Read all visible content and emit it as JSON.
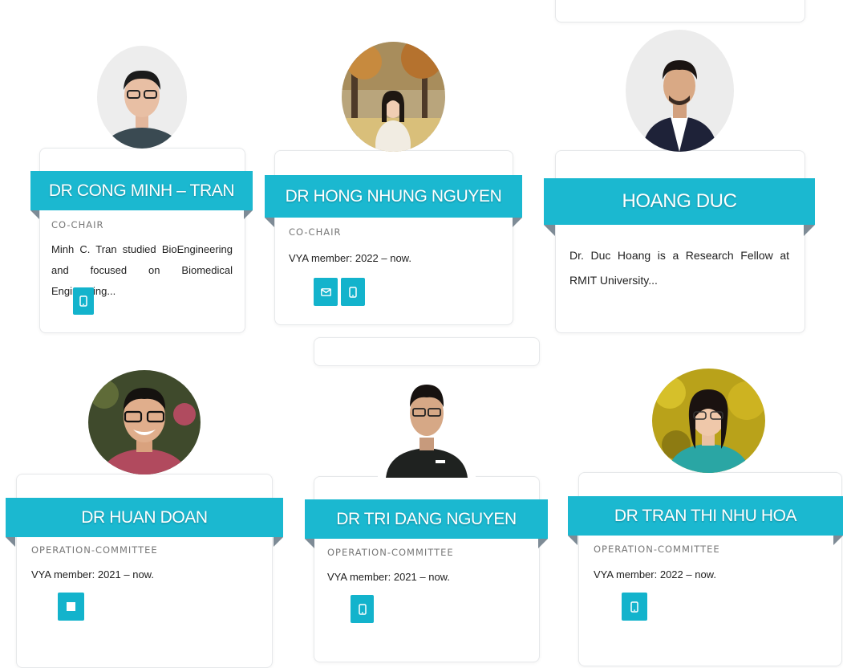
{
  "colors": {
    "accent": "#1bb8d0",
    "accent_dark": "#7e8b96"
  },
  "members": [
    {
      "name": "DR CONG MINH – TRAN",
      "role": "CO-CHAIR",
      "description": "Minh C. Tran studied BioEngineering and focused on Biomedical Engineering...",
      "buttons": [
        "phone-icon"
      ]
    },
    {
      "name": "DR HONG NHUNG NGUYEN",
      "role": "CO-CHAIR",
      "description": "VYA member: 2022 – now.",
      "buttons": [
        "mail-icon",
        "phone-icon"
      ]
    },
    {
      "name": "HOANG DUC",
      "role": "",
      "description": "Dr. Duc Hoang is a Research Fellow at RMIT University...",
      "buttons": []
    },
    {
      "name": "DR HUAN DOAN",
      "role": "OPERATION-COMMITTEE",
      "description": "VYA member: 2021 – now.",
      "buttons": [
        "stop-icon"
      ]
    },
    {
      "name": "DR TRI DANG NGUYEN",
      "role": "OPERATION-COMMITTEE",
      "description": "VYA member: 2021 – now.",
      "buttons": [
        "phone-icon"
      ]
    },
    {
      "name": "DR TRAN THI NHU HOA",
      "role": "OPERATION-COMMITTEE",
      "description": "VYA member: 2022 – now.",
      "buttons": [
        "phone-icon"
      ]
    }
  ]
}
